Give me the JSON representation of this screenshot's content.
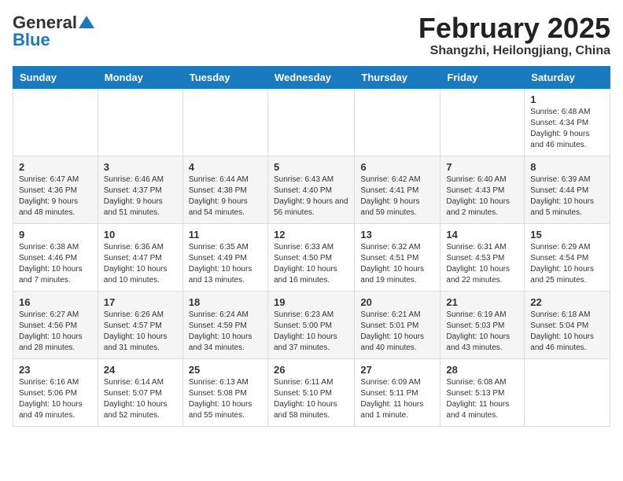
{
  "header": {
    "logo_general": "General",
    "logo_blue": "Blue",
    "month_title": "February 2025",
    "location": "Shangzhi, Heilongjiang, China"
  },
  "days_of_week": [
    "Sunday",
    "Monday",
    "Tuesday",
    "Wednesday",
    "Thursday",
    "Friday",
    "Saturday"
  ],
  "weeks": [
    [
      {
        "day": "",
        "info": ""
      },
      {
        "day": "",
        "info": ""
      },
      {
        "day": "",
        "info": ""
      },
      {
        "day": "",
        "info": ""
      },
      {
        "day": "",
        "info": ""
      },
      {
        "day": "",
        "info": ""
      },
      {
        "day": "1",
        "info": "Sunrise: 6:48 AM\nSunset: 4:34 PM\nDaylight: 9 hours and 46 minutes."
      }
    ],
    [
      {
        "day": "2",
        "info": "Sunrise: 6:47 AM\nSunset: 4:36 PM\nDaylight: 9 hours and 48 minutes."
      },
      {
        "day": "3",
        "info": "Sunrise: 6:46 AM\nSunset: 4:37 PM\nDaylight: 9 hours and 51 minutes."
      },
      {
        "day": "4",
        "info": "Sunrise: 6:44 AM\nSunset: 4:38 PM\nDaylight: 9 hours and 54 minutes."
      },
      {
        "day": "5",
        "info": "Sunrise: 6:43 AM\nSunset: 4:40 PM\nDaylight: 9 hours and 56 minutes."
      },
      {
        "day": "6",
        "info": "Sunrise: 6:42 AM\nSunset: 4:41 PM\nDaylight: 9 hours and 59 minutes."
      },
      {
        "day": "7",
        "info": "Sunrise: 6:40 AM\nSunset: 4:43 PM\nDaylight: 10 hours and 2 minutes."
      },
      {
        "day": "8",
        "info": "Sunrise: 6:39 AM\nSunset: 4:44 PM\nDaylight: 10 hours and 5 minutes."
      }
    ],
    [
      {
        "day": "9",
        "info": "Sunrise: 6:38 AM\nSunset: 4:46 PM\nDaylight: 10 hours and 7 minutes."
      },
      {
        "day": "10",
        "info": "Sunrise: 6:36 AM\nSunset: 4:47 PM\nDaylight: 10 hours and 10 minutes."
      },
      {
        "day": "11",
        "info": "Sunrise: 6:35 AM\nSunset: 4:49 PM\nDaylight: 10 hours and 13 minutes."
      },
      {
        "day": "12",
        "info": "Sunrise: 6:33 AM\nSunset: 4:50 PM\nDaylight: 10 hours and 16 minutes."
      },
      {
        "day": "13",
        "info": "Sunrise: 6:32 AM\nSunset: 4:51 PM\nDaylight: 10 hours and 19 minutes."
      },
      {
        "day": "14",
        "info": "Sunrise: 6:31 AM\nSunset: 4:53 PM\nDaylight: 10 hours and 22 minutes."
      },
      {
        "day": "15",
        "info": "Sunrise: 6:29 AM\nSunset: 4:54 PM\nDaylight: 10 hours and 25 minutes."
      }
    ],
    [
      {
        "day": "16",
        "info": "Sunrise: 6:27 AM\nSunset: 4:56 PM\nDaylight: 10 hours and 28 minutes."
      },
      {
        "day": "17",
        "info": "Sunrise: 6:26 AM\nSunset: 4:57 PM\nDaylight: 10 hours and 31 minutes."
      },
      {
        "day": "18",
        "info": "Sunrise: 6:24 AM\nSunset: 4:59 PM\nDaylight: 10 hours and 34 minutes."
      },
      {
        "day": "19",
        "info": "Sunrise: 6:23 AM\nSunset: 5:00 PM\nDaylight: 10 hours and 37 minutes."
      },
      {
        "day": "20",
        "info": "Sunrise: 6:21 AM\nSunset: 5:01 PM\nDaylight: 10 hours and 40 minutes."
      },
      {
        "day": "21",
        "info": "Sunrise: 6:19 AM\nSunset: 5:03 PM\nDaylight: 10 hours and 43 minutes."
      },
      {
        "day": "22",
        "info": "Sunrise: 6:18 AM\nSunset: 5:04 PM\nDaylight: 10 hours and 46 minutes."
      }
    ],
    [
      {
        "day": "23",
        "info": "Sunrise: 6:16 AM\nSunset: 5:06 PM\nDaylight: 10 hours and 49 minutes."
      },
      {
        "day": "24",
        "info": "Sunrise: 6:14 AM\nSunset: 5:07 PM\nDaylight: 10 hours and 52 minutes."
      },
      {
        "day": "25",
        "info": "Sunrise: 6:13 AM\nSunset: 5:08 PM\nDaylight: 10 hours and 55 minutes."
      },
      {
        "day": "26",
        "info": "Sunrise: 6:11 AM\nSunset: 5:10 PM\nDaylight: 10 hours and 58 minutes."
      },
      {
        "day": "27",
        "info": "Sunrise: 6:09 AM\nSunset: 5:11 PM\nDaylight: 11 hours and 1 minute."
      },
      {
        "day": "28",
        "info": "Sunrise: 6:08 AM\nSunset: 5:13 PM\nDaylight: 11 hours and 4 minutes."
      },
      {
        "day": "",
        "info": ""
      }
    ]
  ]
}
